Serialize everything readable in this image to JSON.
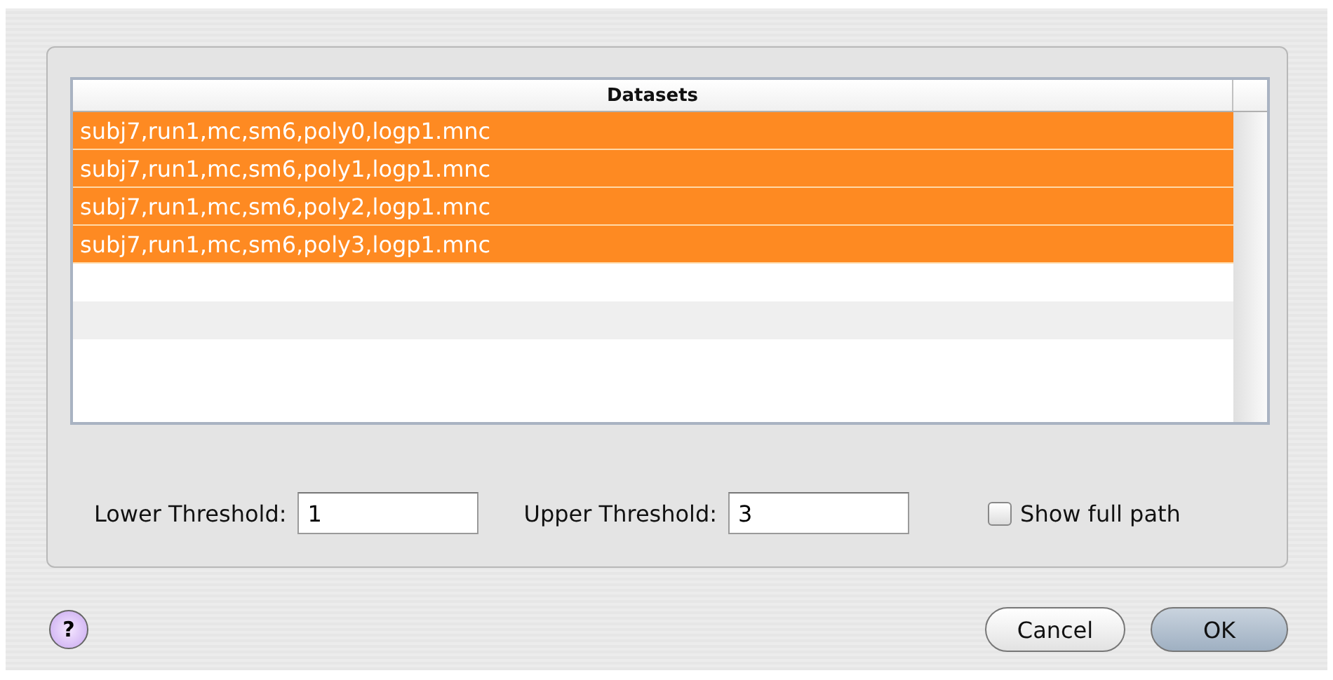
{
  "table": {
    "columns": [
      "Datasets"
    ],
    "rows": [
      {
        "name": "subj7,run1,mc,sm6,poly0,logp1.mnc",
        "selected": true
      },
      {
        "name": "subj7,run1,mc,sm6,poly1,logp1.mnc",
        "selected": true
      },
      {
        "name": "subj7,run1,mc,sm6,poly2,logp1.mnc",
        "selected": true
      },
      {
        "name": "subj7,run1,mc,sm6,poly3,logp1.mnc",
        "selected": true
      }
    ]
  },
  "fields": [
    {
      "label": "Lower Threshold:",
      "value": "1"
    },
    {
      "label": "Upper Threshold:",
      "value": "3"
    }
  ],
  "show_full_path": {
    "label": "Show full path",
    "checked": false
  },
  "help": {
    "label": "?"
  },
  "buttons": [
    {
      "label": "Cancel",
      "default": false
    },
    {
      "label": "OK",
      "default": true
    }
  ]
}
